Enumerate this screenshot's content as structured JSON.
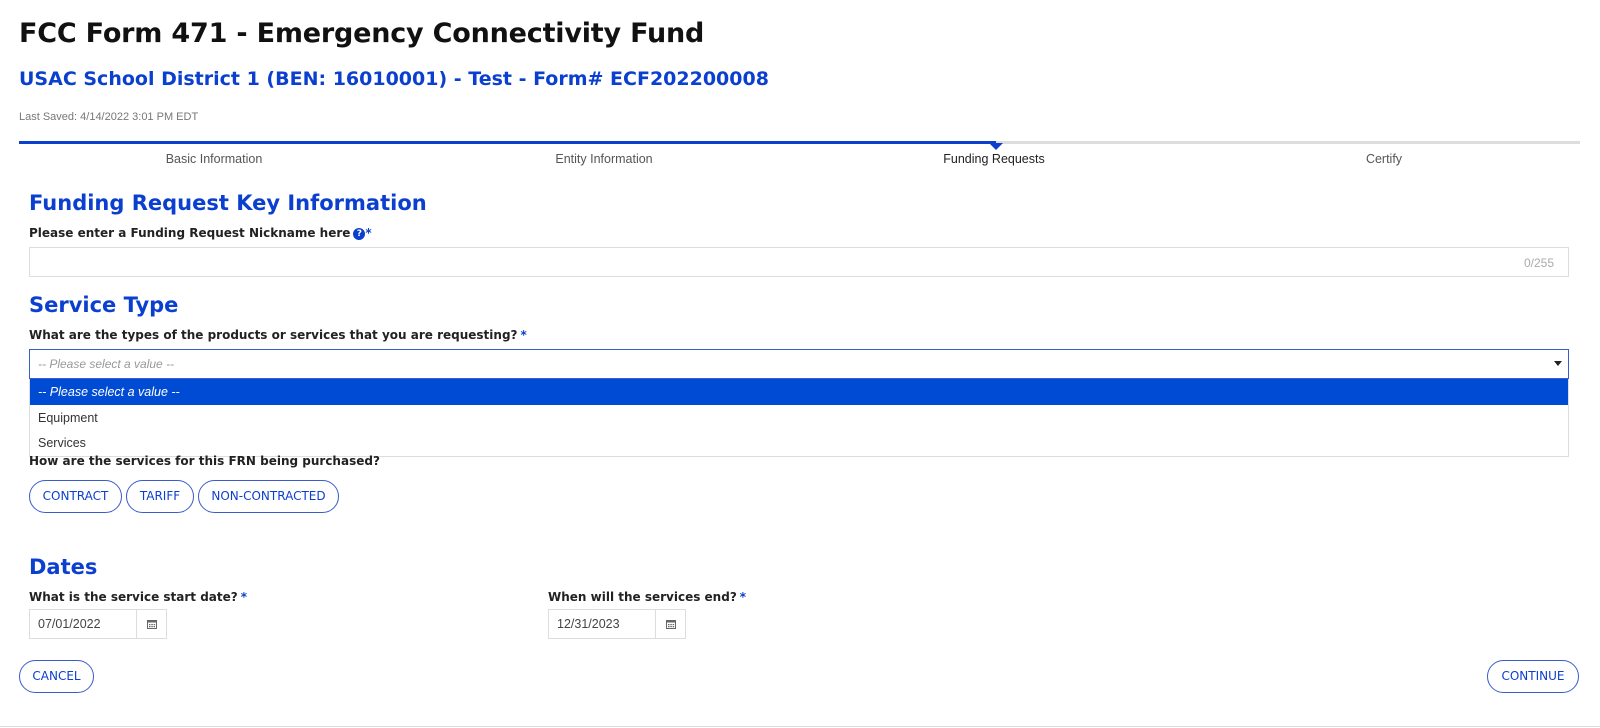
{
  "header": {
    "title": "FCC Form 471 - Emergency Connectivity Fund",
    "subtitle": "USAC School District 1 (BEN: 16010001) - Test  - Form# ECF202200008",
    "last_saved": "Last Saved: 4/14/2022 3:01 PM EDT"
  },
  "progress": {
    "steps": [
      {
        "label": "Basic Information",
        "state": "complete"
      },
      {
        "label": "Entity Information",
        "state": "complete"
      },
      {
        "label": "Funding Requests",
        "state": "active"
      },
      {
        "label": "Certify",
        "state": "upcoming"
      }
    ],
    "current_step": 3,
    "total_steps": 4,
    "accent_color": "#0b3fcf"
  },
  "key_info": {
    "heading": "Funding Request Key Information",
    "nickname_label": "Please enter a Funding Request Nickname here",
    "nickname_value": "",
    "nickname_counter": "0/255",
    "required_mark": "*",
    "help_icon": "question-circle-icon"
  },
  "service_type": {
    "heading": "Service Type",
    "question": "What are the types of the products or services that you are requesting?",
    "required_mark": "*",
    "selected_value": "-- Please select a value --",
    "options": [
      {
        "label": "-- Please select a value --",
        "highlighted": true
      },
      {
        "label": "Equipment",
        "highlighted": false
      },
      {
        "label": "Services",
        "highlighted": false
      }
    ],
    "purchase_question": "How are the services for this FRN being purchased?",
    "purchase_options": [
      "CONTRACT",
      "TARIFF",
      "NON-CONTRACTED"
    ]
  },
  "dates": {
    "heading": "Dates",
    "start_label": "What is the service start date?",
    "start_value": "07/01/2022",
    "end_label": "When will the services end?",
    "end_value": "12/31/2023",
    "required_mark": "*",
    "calendar_icon": "calendar-icon"
  },
  "footer": {
    "cancel_label": "CANCEL",
    "continue_label": "CONTINUE"
  },
  "colors": {
    "brand_blue": "#0b3fcf",
    "selected_option_bg": "#004bd4"
  }
}
